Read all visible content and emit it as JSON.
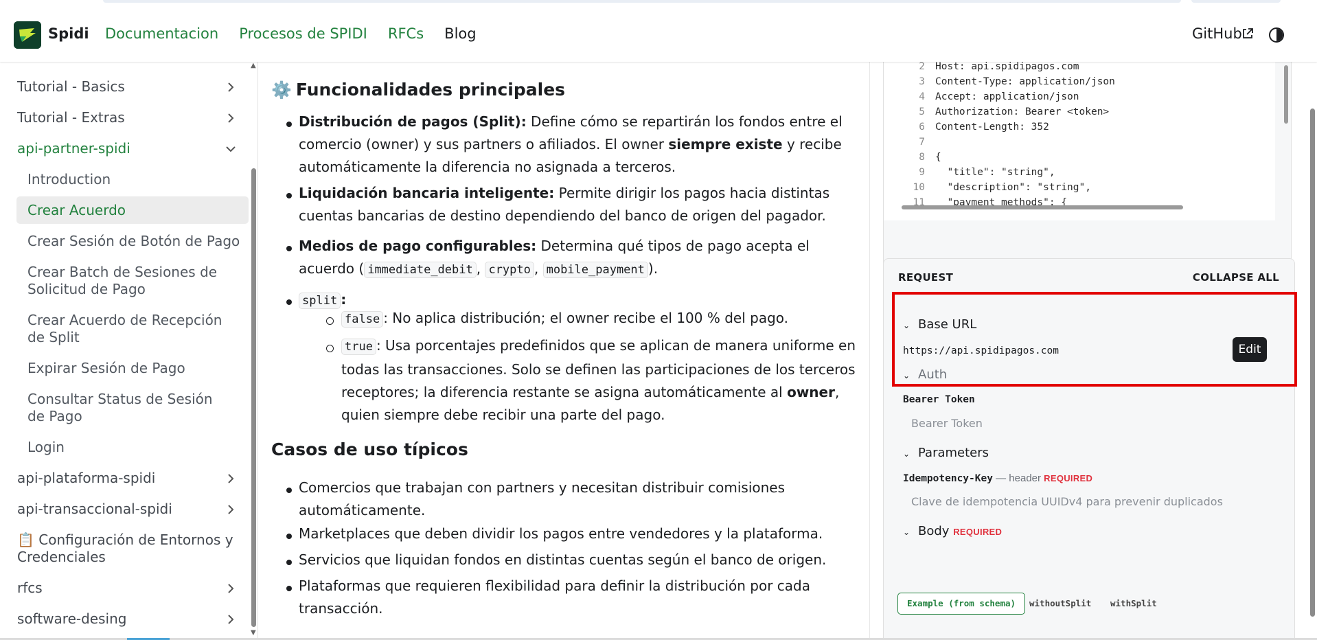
{
  "navbar": {
    "brand": "Spidi",
    "links": [
      "Documentacion",
      "Procesos de SPIDI",
      "RFCs",
      "Blog"
    ],
    "github": "GitHub"
  },
  "sidebar": {
    "items": [
      {
        "label": "Tutorial - Basics",
        "expandable": true
      },
      {
        "label": "Tutorial - Extras",
        "expandable": true
      },
      {
        "label": "api-partner-spidi",
        "expandable": true,
        "expanded": true
      },
      {
        "label": "api-plataforma-spidi",
        "expandable": true
      },
      {
        "label": "api-transaccional-spidi",
        "expandable": true
      },
      {
        "label": "📋 Configuración de Entornos y Credenciales",
        "expandable": false
      },
      {
        "label": "rfcs",
        "expandable": true
      },
      {
        "label": "software-desing",
        "expandable": true
      }
    ],
    "subitems": [
      {
        "label": "Introduction"
      },
      {
        "label": "Crear Acuerdo",
        "selected": true
      },
      {
        "label": "Crear Sesión de Botón de Pago"
      },
      {
        "label": "Crear Batch de Sesiones de Solicitud de Pago"
      },
      {
        "label": "Crear Acuerdo de Recepción de Split"
      },
      {
        "label": "Expirar Sesión de Pago"
      },
      {
        "label": "Consultar Status de Sesión de Pago"
      },
      {
        "label": "Login"
      }
    ]
  },
  "main": {
    "heading": "Funcionalidades principales",
    "heading_icon": "⚙️",
    "b1_bold": "Distribución de pagos (Split):",
    "b1_text1": " Define cómo se repartirán los fondos entre el comercio (owner) y sus partners o afiliados. El owner ",
    "b1_bold2": "siempre existe",
    "b1_text2": " y recibe automáticamente la diferencia no asignada a terceros.",
    "b2_bold": "Liquidación bancaria inteligente:",
    "b2_text": " Permite dirigir los pagos hacia distintas cuentas bancarias de destino dependiendo del banco de origen del pagador.",
    "b3_bold": "Medios de pago configurables:",
    "b3_text": " Determina qué tipos de pago acepta el acuerdo (",
    "b3_code1": "immediate_debit",
    "b3_code2": "crypto",
    "b3_code3": "mobile_payment",
    "b3_end": ").",
    "b4_code": "split",
    "b4_colon": ":",
    "s1_code": "false",
    "s1_text": ": No aplica distribución; el owner recibe el 100 % del pago.",
    "s2_code": "true",
    "s2_text1": ": Usa porcentajes predefinidos que se aplican de manera uniforme en todas las transacciones. Solo se definen las participaciones de los terceros receptores; la diferencia restante se asigna automáticamente al ",
    "s2_bold": "owner",
    "s2_text2": ", quien siempre debe recibir una parte del pago.",
    "uses_heading": "Casos de uso típicos",
    "uses": [
      "Comercios que trabajan con partners y necesitan distribuir comisiones automáticamente.",
      "Marketplaces que deben dividir los pagos entre vendedores y la plataforma.",
      "Servicios que liquidan fondos en distintas cuentas según el banco de origen.",
      "Plataformas que requieren flexibilidad para definir la distribución por cada transacción."
    ]
  },
  "code": {
    "lines": [
      {
        "n": "2",
        "t": "Host: api.spidipagos.com"
      },
      {
        "n": "3",
        "t": "Content-Type: application/json"
      },
      {
        "n": "4",
        "t": "Accept: application/json"
      },
      {
        "n": "5",
        "t": "Authorization: Bearer <token>"
      },
      {
        "n": "6",
        "t": "Content-Length: 352"
      },
      {
        "n": "7",
        "t": ""
      },
      {
        "n": "8",
        "t": "{"
      },
      {
        "n": "9",
        "t": "  \"title\": \"string\","
      },
      {
        "n": "10",
        "t": "  \"description\": \"string\","
      },
      {
        "n": "11",
        "t": "  \"payment_methods\": {"
      }
    ]
  },
  "request": {
    "title": "REQUEST",
    "collapse_all": "COLLAPSE ALL",
    "base_url_label": "Base URL",
    "base_url_value": "https://api.spidipagos.com",
    "edit": "Edit",
    "auth_label": "Auth",
    "bearer_label": "Bearer Token",
    "bearer_placeholder": "Bearer Token",
    "params_label": "Parameters",
    "param_name": "Idempotency-Key",
    "param_meta": " — header ",
    "param_required": "REQUIRED",
    "param_placeholder": "Clave de idempotencia UUIDv4 para prevenir duplicados",
    "body_label": "Body",
    "body_required": "REQUIRED",
    "tabs": [
      "Example (from schema)",
      "withoutSplit",
      "withSplit"
    ]
  },
  "colors": {
    "accent": "#23823f",
    "required": "#e0313d",
    "highlight": "#e20000"
  }
}
